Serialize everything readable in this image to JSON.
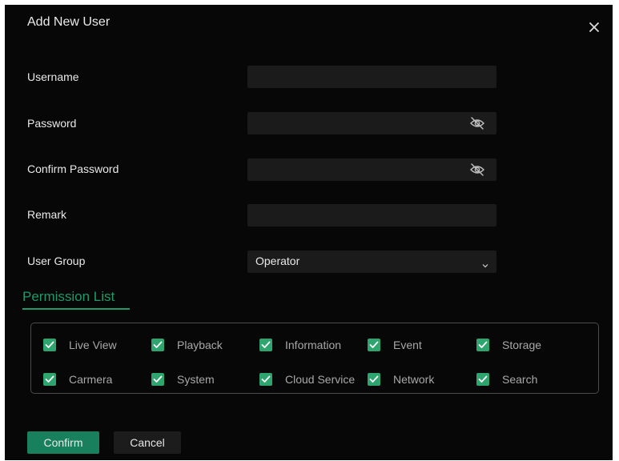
{
  "dialog": {
    "title": "Add New User",
    "close_icon": "close-icon"
  },
  "form": {
    "username": {
      "label": "Username",
      "value": "",
      "placeholder": ""
    },
    "password": {
      "label": "Password",
      "value": "",
      "placeholder": "",
      "icon": "eye-off-icon"
    },
    "confirm_password": {
      "label": "Confirm Password",
      "value": "",
      "placeholder": "",
      "icon": "eye-off-icon"
    },
    "remark": {
      "label": "Remark",
      "value": "",
      "placeholder": ""
    },
    "user_group": {
      "label": "User Group",
      "selected": "Operator",
      "icon": "chevron-down-icon"
    }
  },
  "permissions": {
    "title": "Permission List",
    "items": [
      {
        "label": "Live View",
        "checked": true
      },
      {
        "label": "Playback",
        "checked": true
      },
      {
        "label": "Information",
        "checked": true
      },
      {
        "label": "Event",
        "checked": true
      },
      {
        "label": "Storage",
        "checked": true
      },
      {
        "label": "Carmera",
        "checked": true
      },
      {
        "label": "System",
        "checked": true
      },
      {
        "label": "Cloud Service",
        "checked": true
      },
      {
        "label": "Network",
        "checked": true
      },
      {
        "label": "Search",
        "checked": true
      }
    ]
  },
  "actions": {
    "confirm_label": "Confirm",
    "cancel_label": "Cancel"
  },
  "colors": {
    "accent": "#1f9a6a",
    "checkbox": "#2ea56f",
    "confirm_button": "#18805c",
    "background": "#070707",
    "field": "#1b1b1b"
  }
}
